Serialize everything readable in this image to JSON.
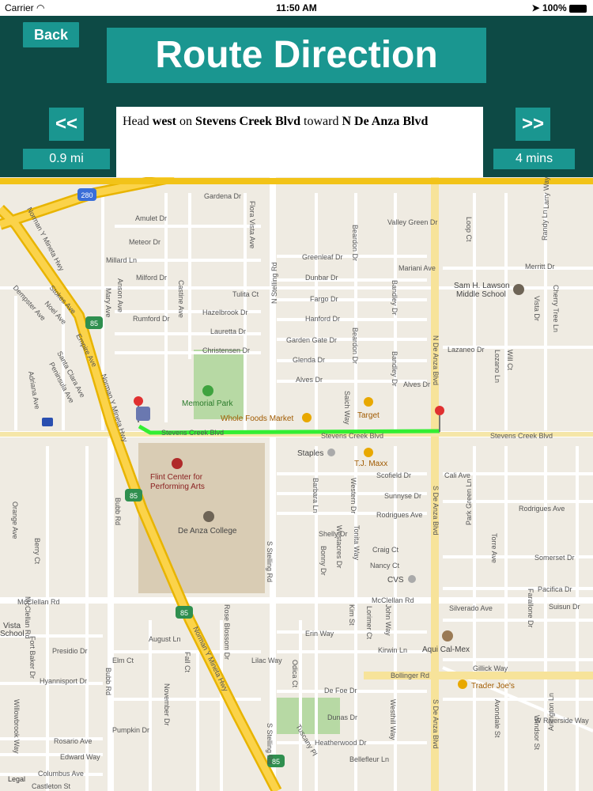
{
  "status_bar": {
    "carrier": "Carrier",
    "time": "11:50 AM",
    "battery": "100%"
  },
  "header": {
    "back_label": "Back",
    "title": "Route Direction",
    "prev_label": "<<",
    "next_label": ">>",
    "distance": "0.9 mi",
    "duration": "4 mins",
    "instruction": {
      "t1": "Head ",
      "dir": "west",
      "t2": " on ",
      "street": "Stevens Creek Blvd",
      "t3": " toward ",
      "target": "N De Anza Blvd"
    }
  },
  "map": {
    "legal": "Legal",
    "highway_shields": [
      "280",
      "85",
      "85",
      "85",
      "85"
    ],
    "pois": {
      "memorial_park": "Memorial Park",
      "whole_foods": "Whole Foods Market",
      "target": "Target",
      "staples": "Staples",
      "tj_maxx": "T.J. Maxx",
      "flint_center_1": "Flint Center for",
      "flint_center_2": "Performing Arts",
      "de_anza_college": "De Anza College",
      "cvs": "CVS",
      "lawson_1": "Sam H. Lawson",
      "lawson_2": "Middle School",
      "aqui": "Aqui Cal-Mex",
      "trader_joes": "Trader Joe's",
      "vista_1": "Vista",
      "vista_2": "School"
    },
    "streets": {
      "gardena": "Gardena Dr",
      "amulet": "Amulet Dr",
      "meteor": "Meteor Dr",
      "millard": "Millard Ln",
      "milford": "Milford Dr",
      "rumford": "Rumford Dr",
      "hazelbrook": "Hazelbrook Dr",
      "lauretta": "Lauretta Dr",
      "christensen": "Christensen Dr",
      "glenda": "Glenda Dr",
      "alves": "Alves Dr",
      "alves2": "Alves Dr",
      "tulita": "Tulita Ct",
      "greenleaf": "Greenleaf Dr",
      "dunbar": "Dunbar Dr",
      "fargo": "Fargo Dr",
      "hanford": "Hanford Dr",
      "gardengate": "Garden Gate Dr",
      "valleygreen": "Valley Green Dr",
      "mariani": "Mariani Ave",
      "merritt": "Merritt Dr",
      "lazaneo": "Lazaneo Dr",
      "stevens_w": "Stevens Creek Blvd",
      "stevens_c": "Stevens Creek Blvd",
      "stevens_e": "Stevens Creek Blvd",
      "scofield": "Scofield Dr",
      "sunnyse": "Sunnyse Dr",
      "rodrigues": "Rodrigues Ave",
      "rodrigues2": "Rodrigues Ave",
      "cali": "Cali Ave",
      "shelly": "Shelly Dr",
      "craig": "Craig Ct",
      "nancy": "Nancy Ct",
      "mcclellan": "McClellan Rd",
      "mcclellan2": "McClellan Rd",
      "silverado": "Silverado Ave",
      "somerset": "Somerset Dr",
      "pacifica": "Pacifica Dr",
      "suisun": "Suisun Dr",
      "erin": "Erin Way",
      "kirwin": "Kirwin Ln",
      "bollinger": "Bollinger Rd",
      "gillick": "Gillick Way",
      "riverside": "W Riverside Way",
      "presidio": "Presidio Dr",
      "elm": "Elm Ct",
      "hyannisport": "Hyannisport Dr",
      "rosario": "Rosario Ave",
      "edward": "Edward Way",
      "columbus": "Columbus Ave",
      "castleton": "Castleton St",
      "pumpkin": "Pumpkin Dr",
      "heatherwood": "Heatherwood Dr",
      "dunas": "Dunas Dr",
      "defoe": "De Foe Dr",
      "lilac": "Lilac Way",
      "august": "August Ln",
      "fall": "Fall Ct",
      "november": "November Dr",
      "bellefleur": "Bellefleur Ln",
      "dempster": "Dempster Ave",
      "stokes": "Stokes Ave",
      "noel": "Noel Ave",
      "empire": "Empire Ave",
      "santaclara": "Santa Clara Ave",
      "peninsula": "Peninsula Ave",
      "adriana": "Adriana Ave",
      "n_stelling": "N Stelling Rd",
      "s_stelling": "S Stelling Rd",
      "s_stelling2": "S Stelling Rd",
      "n_deanza": "N De Anza Blvd",
      "s_deanza": "S De Anza Blvd",
      "s_deanza2": "S De Anza Blvd",
      "bubb": "Bubb Rd",
      "bubb2": "Bubb Rd",
      "flora": "Flora Vista Ave",
      "castine": "Castine Ave",
      "anson": "Anson Ave",
      "mary": "Mary Ave",
      "beardon": "Beardon Dr",
      "bandley": "Bandley Dr",
      "saich": "Saich Way",
      "barbara": "Barbara Ln",
      "westacres": "Westacres Dr",
      "tonita": "Tonita Way",
      "western": "Western Dr",
      "bonny": "Bonny Dr",
      "orange": "Orange Ave",
      "berry": "Berry Ct",
      "norman1": "Norman Y Mineta Hwy",
      "norman2": "Norman Y Mineta Hwy",
      "norman3": "Norman Y Mineta Hwy",
      "rose": "Rose Blossom Dr",
      "odica": "Odica Ct",
      "lorimer": "Lorimer Ct",
      "kim": "Kim St",
      "johnway": "John Way",
      "westhill": "Westhill Way",
      "tuscany": "Tuscany Pl",
      "park": "Park Green Ln",
      "torre": "Torre Ave",
      "avondale": "Avondale St",
      "windsor": "Windsor St",
      "arlington": "Arlington Ln",
      "larry": "Larry Way",
      "randy": "Randy Ln",
      "vista": "Vista Dr",
      "cherry": "Cherry Tree Ln",
      "will": "Will Ct",
      "lozano": "Lozano Ln",
      "farallone": "Farallone Dr",
      "loop": "Loop Ct",
      "fort": "Fort Baker Dr",
      "willowbrook": "Willowbrook Way",
      "mcclellan_v": "McClellan Rd"
    }
  }
}
